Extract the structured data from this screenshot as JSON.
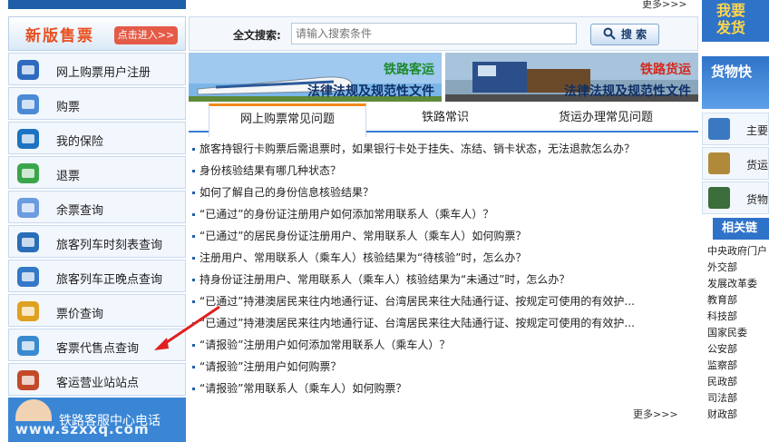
{
  "sidebar": {
    "banner_title": "新版售票",
    "banner_button": "点击进入>>",
    "items": [
      {
        "label": "网上购票用户注册",
        "icon": "user-register-icon"
      },
      {
        "label": "购票",
        "icon": "ticket-icon"
      },
      {
        "label": "我的保险",
        "icon": "insurance-shield-icon"
      },
      {
        "label": "退票",
        "icon": "refund-arrow-icon"
      },
      {
        "label": "余票查询",
        "icon": "remaining-tickets-icon"
      },
      {
        "label": "旅客列车时刻表查询",
        "icon": "train-schedule-icon"
      },
      {
        "label": "旅客列车正晚点查询",
        "icon": "clock-icon"
      },
      {
        "label": "票价查询",
        "icon": "price-yen-icon"
      },
      {
        "label": "客票代售点查询",
        "icon": "agency-store-icon"
      },
      {
        "label": "客运营业站站点",
        "icon": "station-house-icon"
      }
    ],
    "phone_label": "铁路客服中心电话",
    "watermark": "www.szxxq.com"
  },
  "search": {
    "label": "全文搜索:",
    "placeholder": "请输入搜索条件",
    "button": "搜 索"
  },
  "more_top": "更多>>>",
  "more_bottom": "更多>>>",
  "banners": [
    {
      "title": "铁路客运",
      "subtitle": "法律法规及规范性文件",
      "title_color": "#1b8a2c"
    },
    {
      "title": "铁路货运",
      "subtitle": "法律法规及规范性文件",
      "title_color": "#d4281c"
    }
  ],
  "tabs": [
    {
      "label": "网上购票常见问题",
      "active": true
    },
    {
      "label": "铁路常识",
      "active": false
    },
    {
      "label": "货运办理常见问题",
      "active": false
    }
  ],
  "questions": [
    "旅客持银行卡购票后需退票时，如果银行卡处于挂失、冻结、销卡状态，无法退款怎么办？",
    "身份核验结果有哪几种状态？",
    "如何了解自己的身份信息核验结果？",
    "“已通过”的身份证注册用户如何添加常用联系人（乘车人）？",
    "“已通过”的居民身份证注册用户、常用联系人（乘车人）如何购票？",
    "注册用户、常用联系人（乘车人）核验结果为“待核验”时，怎么办？",
    "持身份证注册用户、常用联系人（乘车人）核验结果为“未通过”时，怎么办？",
    "“已通过”持港澳居民来往内地通行证、台湾居民来往大陆通行证、按规定可使用的有效护...",
    "“已通过”持港澳居民来往内地通行证、台湾居民来往大陆通行证、按规定可使用的有效护...",
    "“请报验”注册用户如何添加常用联系人（乘车人）？",
    "“请报验”注册用户如何购票？",
    "“请报验”常用联系人（乘车人）如何购票？"
  ],
  "right": {
    "top_button": [
      "我要",
      "发货"
    ],
    "cargo_banner": "货物快",
    "links": [
      {
        "label": "主要",
        "icon": "ledger-icon"
      },
      {
        "label": "货运",
        "icon": "calculator-icon"
      },
      {
        "label": "货物",
        "icon": "freight-train-icon"
      }
    ],
    "related_title": "相关链",
    "related": [
      "中央政府门户",
      "外交部",
      "发展改革委",
      "教育部",
      "科技部",
      "国家民委",
      "公安部",
      "监察部",
      "民政部",
      "司法部",
      "财政部"
    ]
  },
  "colors": {
    "brand_blue": "#1f5fa8",
    "tab_accent": "#f08a1c",
    "annotation_arrow": "#e02020"
  }
}
